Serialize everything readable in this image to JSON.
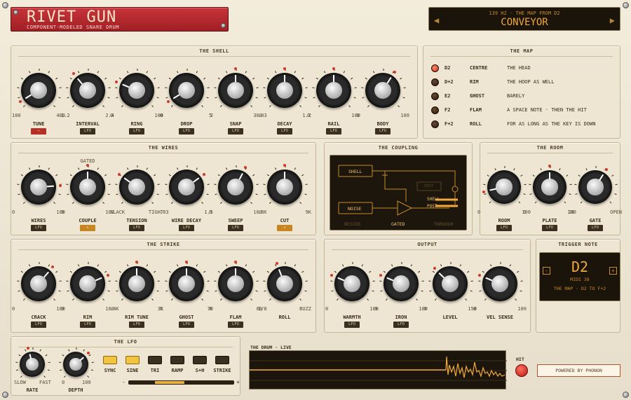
{
  "header": {
    "title": "RIVET GUN",
    "subtitle": "COMPONENT-MODELED SNARE DRUM"
  },
  "preset": {
    "info": "139 HZ · THE MAP FROM D2",
    "name": "CONVEYOR",
    "prev": "◀",
    "next": "▶"
  },
  "panels": {
    "shell": "THE SHELL",
    "map": "THE MAP",
    "wires": "THE WIRES",
    "coupling": "THE COUPLING",
    "room": "THE ROOM",
    "strike": "THE STRIKE",
    "output": "OUTPUT",
    "trigger": "TRIGGER NOTE",
    "lfo": "THE LFO",
    "scope": "THE DRUM · LIVE"
  },
  "shell": [
    {
      "label": "TUNE",
      "min": "100",
      "max": "400",
      "value": 0.05,
      "badge": "red"
    },
    {
      "label": "INTERVAL",
      "min": "1.2",
      "max": "2.4",
      "value": 0.35,
      "badge": "LFO"
    },
    {
      "label": "RING",
      "min": "0",
      "max": "100",
      "value": 0.25,
      "badge": "LFO"
    },
    {
      "label": "DROP",
      "min": "0",
      "max": "2",
      "value": 0.05,
      "badge": "LFO"
    },
    {
      "label": "SNAP",
      "min": "5",
      "max": "300",
      "value": 0.5,
      "badge": "LFO"
    },
    {
      "label": "DECAY",
      "min": ".03",
      "max": "1.2",
      "value": 0.5,
      "badge": "LFO"
    },
    {
      "label": "RAIL",
      "min": "0",
      "max": "100",
      "value": 0.5,
      "badge": "LFO"
    },
    {
      "label": "BODY",
      "min": "0",
      "max": "100",
      "value": 0.62,
      "badge": "LFO"
    }
  ],
  "map": [
    {
      "note": "D2",
      "name": "CENTRE",
      "desc": "THE HEAD",
      "active": true
    },
    {
      "note": "D+2",
      "name": "RIM",
      "desc": "THE HOOP AS WELL",
      "active": false
    },
    {
      "note": "E2",
      "name": "GHOST",
      "desc": "BARELY",
      "active": false
    },
    {
      "note": "F2",
      "name": "FLAM",
      "desc": "A SPACE NOTE · THEN THE HIT",
      "active": false
    },
    {
      "note": "F+2",
      "name": "ROLL",
      "desc": "FOR AS LONG AS THE KEY IS DOWN",
      "active": false
    }
  ],
  "wires": [
    {
      "label": "WIRES",
      "min": "0",
      "max": "100",
      "value": 0.82,
      "badge": "LFO",
      "top": ""
    },
    {
      "label": "COUPLE",
      "min": "0",
      "max": "100",
      "value": 0.5,
      "badge": "on",
      "top": "GATED"
    },
    {
      "label": "TENSION",
      "min": "SLACK",
      "max": "TIGHT",
      "value": 0.3,
      "badge": "LFO",
      "top": ""
    },
    {
      "label": "WIRE DECAY",
      "min": ".03",
      "max": "1.5",
      "value": 0.7,
      "badge": "LFO",
      "top": ""
    },
    {
      "label": "SWEEP",
      "min": "0",
      "max": "100",
      "value": 0.6,
      "badge": "LFO",
      "top": ""
    },
    {
      "label": "CUT",
      "min": ".8K",
      "max": "9K",
      "value": 0.5,
      "badge": "on",
      "top": ""
    }
  ],
  "coupling": {
    "shell": "SHELL",
    "noise": "NOISE",
    "emit": "EMIT",
    "shell_out": "SHELL",
    "post": "POST",
    "modes": [
      "BESIDE",
      "GATED",
      "THROUGH"
    ]
  },
  "room": [
    {
      "label": "ROOM",
      "min": "0",
      "max": "100",
      "value": 0.12,
      "badge": "LFO"
    },
    {
      "label": "PLATE",
      "min": "0",
      "max": "100",
      "value": 0.5,
      "badge": "LFO"
    },
    {
      "label": "GATE",
      "min": "20",
      "max": "OPEN",
      "value": 0.62,
      "badge": "LFO"
    }
  ],
  "strike": [
    {
      "label": "CRACK",
      "min": "0",
      "max": "100",
      "value": 0.65,
      "badge": "LFO"
    },
    {
      "label": "RIM",
      "min": "0",
      "max": "100",
      "value": 0.75,
      "badge": "LFO"
    },
    {
      "label": "RIM TUNE",
      "min": ".4K",
      "max": "3K",
      "value": 0.5,
      "badge": "LFO"
    },
    {
      "label": "GHOST",
      "min": "5",
      "max": "70",
      "value": 0.5,
      "badge": "LFO"
    },
    {
      "label": "FLAM",
      "min": "8",
      "max": "80",
      "value": 0.5,
      "badge": "LFO"
    },
    {
      "label": "ROLL",
      "min": "1/8",
      "max": "BUZZ",
      "value": 0.42,
      "badge": ""
    }
  ],
  "output": [
    {
      "label": "WARMTH",
      "min": "0",
      "max": "100",
      "value": 0.25,
      "badge": "LFO"
    },
    {
      "label": "IRON",
      "min": "0",
      "max": "100",
      "value": 0.25,
      "badge": "LFO"
    },
    {
      "label": "LEVEL",
      "min": "0",
      "max": "150",
      "value": 0.33,
      "badge": ""
    },
    {
      "label": "VEL SENSE",
      "min": "0",
      "max": "100",
      "value": 0.25,
      "badge": ""
    }
  ],
  "trigger": {
    "note": "D2",
    "midi": "MIDI 38",
    "hint": "THE MAP · D2 TO F+2",
    "minus": "-",
    "plus": "+"
  },
  "lfo": {
    "rate_label": "RATE",
    "rate_min": "SLOW",
    "rate_max": "FAST",
    "rate_value": 0.45,
    "depth_label": "DEPTH",
    "depth_min": "0",
    "depth_max": "100",
    "depth_value": 0.68,
    "buttons": [
      {
        "label": "SYNC",
        "on": true
      },
      {
        "label": "SINE",
        "on": true
      },
      {
        "label": "TRI",
        "on": false
      },
      {
        "label": "RAMP",
        "on": false
      },
      {
        "label": "S+H",
        "on": false
      },
      {
        "label": "STRIKE",
        "on": false
      }
    ],
    "slider_minus": "-",
    "slider_plus": "+",
    "slider_value": 0.5
  },
  "hit": {
    "label": "HIT"
  },
  "powered": "POWERED BY PHONON",
  "colors": {
    "accent": "#f2a93a",
    "led": "#d13a2a",
    "plate": "#b8262d"
  }
}
